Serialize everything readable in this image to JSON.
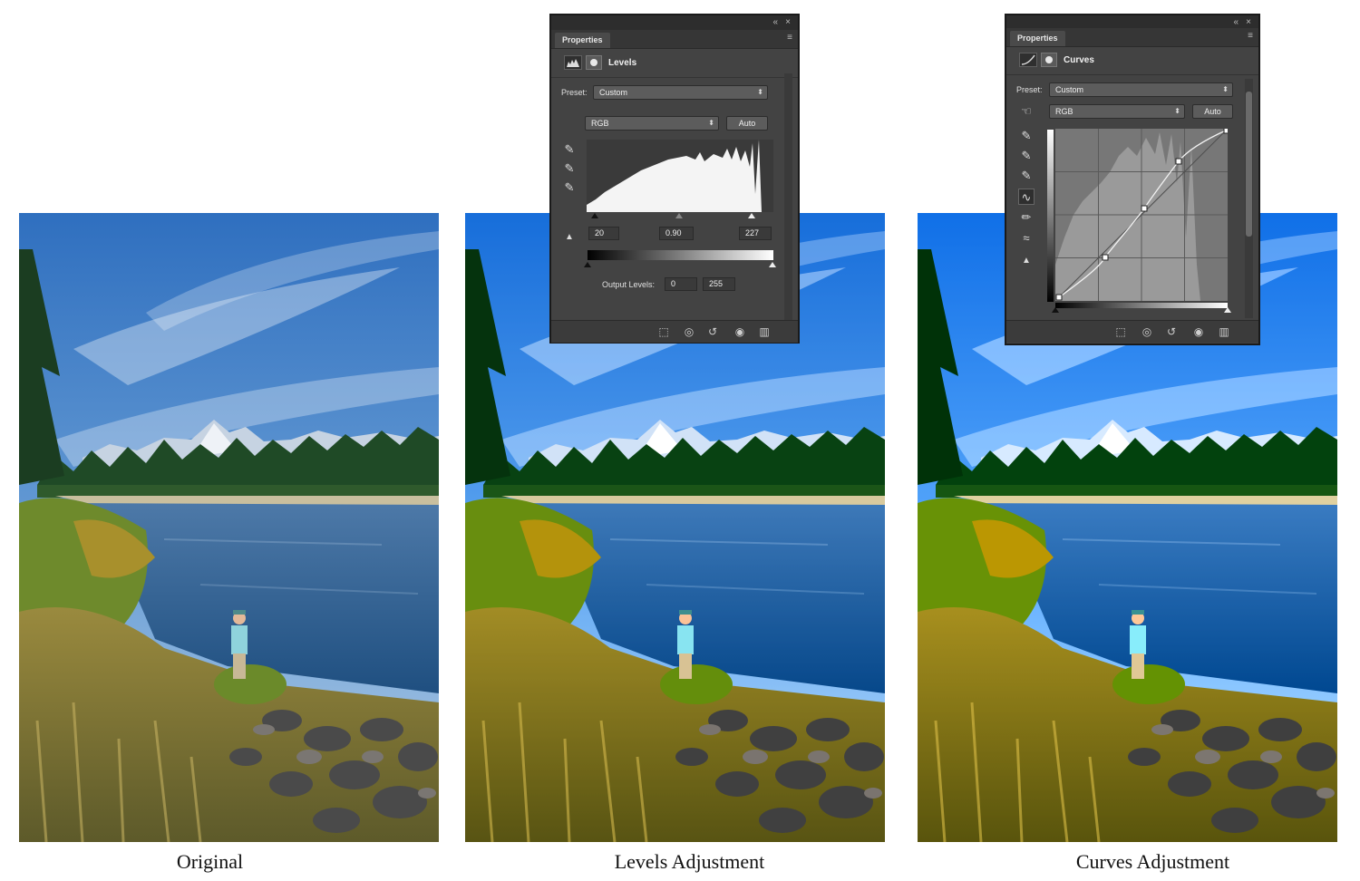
{
  "captions": {
    "original": "Original",
    "levels": "Levels Adjustment",
    "curves": "Curves Adjustment"
  },
  "levels_panel": {
    "tab": "Properties",
    "title": "Levels",
    "preset_label": "Preset:",
    "preset_value": "Custom",
    "channel_value": "RGB",
    "auto_label": "Auto",
    "input_black": "20",
    "input_gamma": "0.90",
    "input_white": "227",
    "output_label": "Output Levels:",
    "output_black": "0",
    "output_white": "255"
  },
  "curves_panel": {
    "tab": "Properties",
    "title": "Curves",
    "preset_label": "Preset:",
    "preset_value": "Custom",
    "channel_value": "RGB",
    "auto_label": "Auto"
  },
  "icons": {
    "collapse": "«",
    "close": "×",
    "menu": "≡"
  },
  "colors": {
    "panel_bg": "#434343",
    "panel_dark": "#2d2d2d",
    "sky": "#3f7ecb",
    "river": "#2f5f90"
  }
}
